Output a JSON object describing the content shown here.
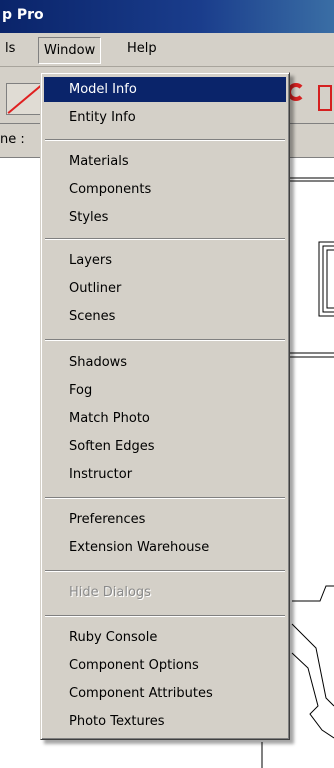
{
  "window": {
    "title": "p Pro"
  },
  "menubar": {
    "tools_partial": "ls",
    "window_label": "Window",
    "help_label": "Help"
  },
  "status": {
    "partial_text": "ne :"
  },
  "window_menu": {
    "items": [
      "Model Info",
      "Entity Info",
      "Materials",
      "Components",
      "Styles",
      "Layers",
      "Outliner",
      "Scenes",
      "Shadows",
      "Fog",
      "Match Photo",
      "Soften Edges",
      "Instructor",
      "Preferences",
      "Extension Warehouse",
      "Hide Dialogs",
      "Ruby Console",
      "Component Options",
      "Component Attributes",
      "Photo Textures"
    ],
    "selected": "Model Info",
    "disabled": [
      "Hide Dialogs"
    ]
  },
  "colors": {
    "highlight": "#0a246a",
    "menu_bg": "#d4d0c8",
    "accent_red": "#d52020"
  }
}
